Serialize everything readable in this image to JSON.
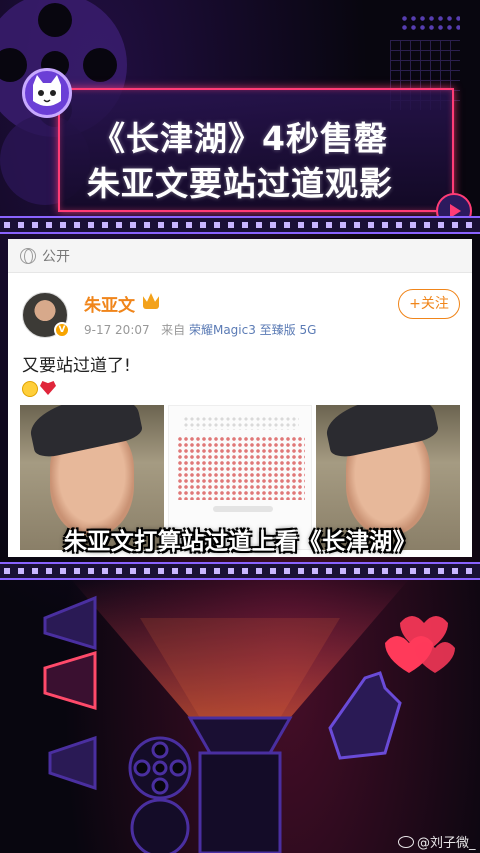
{
  "banner": {
    "title_line1": "《长津湖》4秒售罄",
    "title_line2": "朱亚文要站过道观影"
  },
  "card": {
    "visibility_label": "公开",
    "username": "朱亚文",
    "timestamp": "9-17 20:07",
    "source_prefix": "来自",
    "device": "荣耀Magic3 至臻版 5G",
    "follow_label": "+关注",
    "post_text": "又要站过道了!"
  },
  "subtitle": "朱亚文打算站过道上看《长津湖》",
  "watermark": "@刘子微_",
  "colors": {
    "accent_pink": "#ff3c76",
    "weibo_orange": "#f0851a",
    "strip_purple": "#8a63ff"
  },
  "icons": [
    "cat-logo-icon",
    "play-icon",
    "globe-icon",
    "crown-icon",
    "verified-badge-icon",
    "crying-emoji-icon",
    "broken-heart-icon",
    "weibo-icon",
    "megaphone-icon",
    "film-reel-icon",
    "hearts-icon",
    "hand-icon"
  ]
}
